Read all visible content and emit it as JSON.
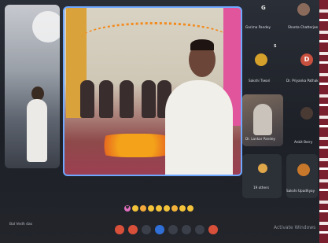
{
  "meeting": {
    "bottom_left_text": "Bal Vedh das",
    "windows_watermark": "Activate Windows"
  },
  "participants_panel": {
    "group_letter_1": "G",
    "group_letter_2": "S",
    "participants": [
      {
        "name": "Garima Pandey",
        "avatar_letter": "",
        "avatar_color": "#2c3037"
      },
      {
        "name": "Shanta Chatterjee",
        "avatar_letter": "",
        "avatar_color": "#8a6a5a"
      },
      {
        "name": "Sakshi Tiwari",
        "avatar_letter": "",
        "avatar_color": "#d6a12a"
      },
      {
        "name": "Dr. Priyanka Pathak",
        "avatar_letter": "D",
        "avatar_color": "#c8503f"
      },
      {
        "name": "Dr. Lankar Pandey",
        "avatar_letter": "",
        "avatar_color": "#6a5a50"
      },
      {
        "name": "Ankit Berry",
        "avatar_letter": "",
        "avatar_color": "#4a3a34"
      },
      {
        "name": "19 others",
        "avatar_letter": "",
        "avatar_color": "#e0a64a"
      },
      {
        "name": "Sakshi Upadhyay",
        "avatar_letter": "",
        "avatar_color": "#c8782a"
      }
    ]
  },
  "reactions": {
    "icons": [
      "heart-icon",
      "thumbs-up-icon",
      "celebrate-icon",
      "laugh-icon",
      "wow-icon",
      "sad-icon",
      "clap-icon",
      "thinking-icon",
      "hand-icon"
    ]
  },
  "controls": {
    "icons": [
      "mic-icon",
      "camera-icon",
      "share-icon",
      "record-icon",
      "captions-icon",
      "raise-hand-icon",
      "more-icon",
      "end-call-icon"
    ]
  }
}
